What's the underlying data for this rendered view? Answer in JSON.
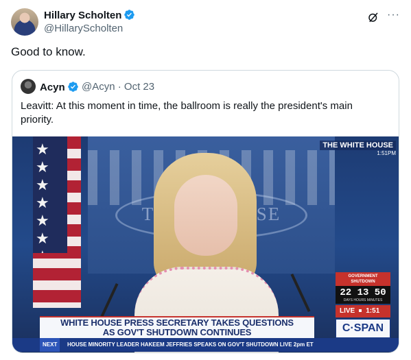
{
  "tweet": {
    "author_name": "Hillary Scholten",
    "author_handle": "@HillaryScholten",
    "text": "Good to know.",
    "more_icon": "···"
  },
  "quote": {
    "author_name": "Acyn",
    "handle_date": "@Acyn · Oct 23",
    "text": "Leavitt: At this moment in time, the ballroom is really the president's main priority."
  },
  "video": {
    "bug_title": "THE WHITE HOUSE",
    "bug_time": "1:51PM",
    "wall_text": "THE W HOUSE",
    "flag_stars": "★ ★ ★ ★ ★ ★ ★ ★ ★ ★ ★ ★",
    "shutdown_label": "GOVERNMENT SHUTDOWN",
    "shutdown_count": "22 13 50",
    "shutdown_units": "DAYS HOURS MINUTES",
    "live_label": "LIVE",
    "live_time": "1:51",
    "headline_line1": "WHITE HOUSE PRESS SECRETARY TAKES QUESTIONS",
    "headline_line2": "AS GOV'T SHUTDOWN CONTINUES",
    "network": "C·SPAN",
    "ticker_next": "NEXT",
    "ticker_text": "HOUSE MINORITY LEADER HAKEEM JEFFRIES SPEAKS ON GOV'T SHUTDOWN LIVE 2pm ET"
  },
  "colors": {
    "verified": "#1d9bf0",
    "handle": "#536471",
    "border": "#cfd9de"
  },
  "icons": {
    "verified": "verified-badge-icon",
    "grok": "grok-icon",
    "more": "more-icon"
  }
}
